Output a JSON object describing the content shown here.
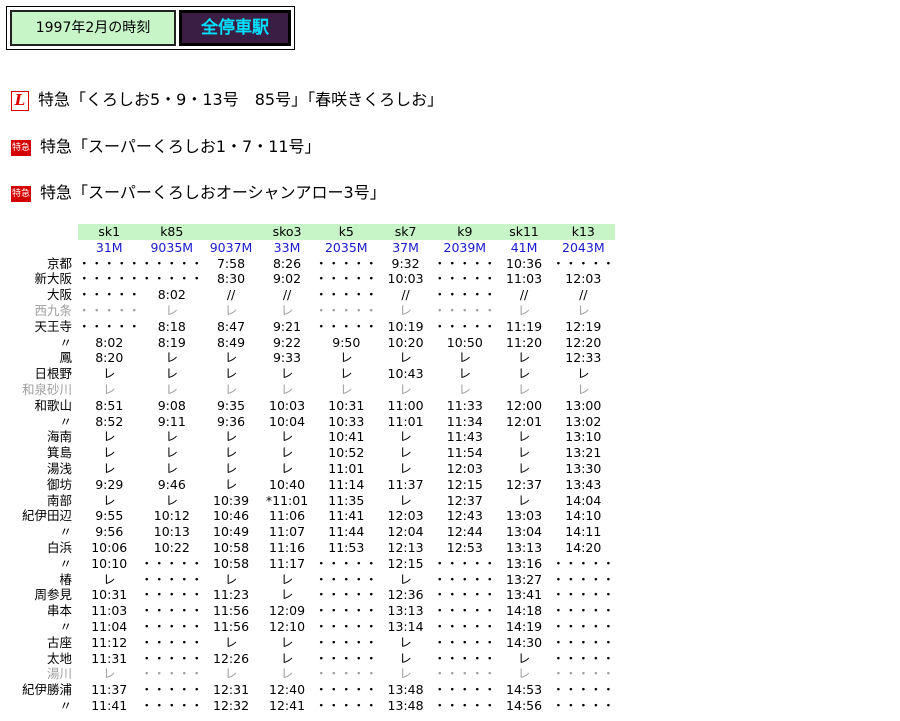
{
  "header": {
    "period": "1997年2月の時刻",
    "category": "全停車駅"
  },
  "services": [
    {
      "icon": "l-mark-icon",
      "label": "特急「くろしお5・9・13号　85号」「春咲きくろしお」"
    },
    {
      "icon": "tokkyu-icon",
      "label": "特急「スーパーくろしお1・7・11号」"
    },
    {
      "icon": "tokkyu-icon",
      "label": "特急「スーパーくろしおオーシャンアロー3号」"
    }
  ],
  "tokkyu_icon_text": "特急",
  "l_mark_text": "L",
  "timetable": {
    "train_names": [
      "sk1",
      "k85",
      "",
      "sko3",
      "k5",
      "sk7",
      "k9",
      "sk11",
      "k13"
    ],
    "train_numbers": [
      "31M",
      "9035M",
      "9037M",
      "33M",
      "2035M",
      "37M",
      "2039M",
      "41M",
      "2043M"
    ],
    "rows": [
      {
        "station": "京都",
        "gray": false,
        "times": [
          "・・・・・",
          "・・・・・",
          "7:58",
          "8:26",
          "・・・・・",
          "9:32",
          "・・・・・",
          "10:36",
          "・・・・・"
        ]
      },
      {
        "station": "新大阪",
        "gray": false,
        "times": [
          "・・・・・",
          "・・・・・",
          "8:30",
          "9:02",
          "・・・・・",
          "10:03",
          "・・・・・",
          "11:03",
          "12:03"
        ]
      },
      {
        "station": "大阪",
        "gray": false,
        "times": [
          "・・・・・",
          "8:02",
          "//",
          "//",
          "・・・・・",
          "//",
          "・・・・・",
          "//",
          "//"
        ]
      },
      {
        "station": "西九条",
        "gray": true,
        "times": [
          "・・・・・",
          "レ",
          "レ",
          "レ",
          "・・・・・",
          "レ",
          "・・・・・",
          "レ",
          "レ"
        ]
      },
      {
        "station": "天王寺",
        "gray": false,
        "times": [
          "・・・・・",
          "8:18",
          "8:47",
          "9:21",
          "・・・・・",
          "10:19",
          "・・・・・",
          "11:19",
          "12:19"
        ]
      },
      {
        "station": "〃",
        "gray": false,
        "times": [
          "8:02",
          "8:19",
          "8:49",
          "9:22",
          "9:50",
          "10:20",
          "10:50",
          "11:20",
          "12:20"
        ]
      },
      {
        "station": "鳳",
        "gray": false,
        "times": [
          "8:20",
          "レ",
          "レ",
          "9:33",
          "レ",
          "レ",
          "レ",
          "レ",
          "12:33"
        ]
      },
      {
        "station": "日根野",
        "gray": false,
        "times": [
          "レ",
          "レ",
          "レ",
          "レ",
          "レ",
          "10:43",
          "レ",
          "レ",
          "レ"
        ]
      },
      {
        "station": "和泉砂川",
        "gray": true,
        "times": [
          "レ",
          "レ",
          "レ",
          "レ",
          "レ",
          "レ",
          "レ",
          "レ",
          "レ"
        ]
      },
      {
        "station": "和歌山",
        "gray": false,
        "times": [
          "8:51",
          "9:08",
          "9:35",
          "10:03",
          "10:31",
          "11:00",
          "11:33",
          "12:00",
          "13:00"
        ]
      },
      {
        "station": "〃",
        "gray": false,
        "times": [
          "8:52",
          "9:11",
          "9:36",
          "10:04",
          "10:33",
          "11:01",
          "11:34",
          "12:01",
          "13:02"
        ]
      },
      {
        "station": "海南",
        "gray": false,
        "times": [
          "レ",
          "レ",
          "レ",
          "レ",
          "10:41",
          "レ",
          "11:43",
          "レ",
          "13:10"
        ]
      },
      {
        "station": "箕島",
        "gray": false,
        "times": [
          "レ",
          "レ",
          "レ",
          "レ",
          "10:52",
          "レ",
          "11:54",
          "レ",
          "13:21"
        ]
      },
      {
        "station": "湯浅",
        "gray": false,
        "times": [
          "レ",
          "レ",
          "レ",
          "レ",
          "11:01",
          "レ",
          "12:03",
          "レ",
          "13:30"
        ]
      },
      {
        "station": "御坊",
        "gray": false,
        "times": [
          "9:29",
          "9:46",
          "レ",
          "10:40",
          "11:14",
          "11:37",
          "12:15",
          "12:37",
          "13:43"
        ]
      },
      {
        "station": "南部",
        "gray": false,
        "times": [
          "レ",
          "レ",
          "10:39",
          "*11:01",
          "11:35",
          "レ",
          "12:37",
          "レ",
          "14:04"
        ]
      },
      {
        "station": "紀伊田辺",
        "gray": false,
        "times": [
          "9:55",
          "10:12",
          "10:46",
          "11:06",
          "11:41",
          "12:03",
          "12:43",
          "13:03",
          "14:10"
        ]
      },
      {
        "station": "〃",
        "gray": false,
        "times": [
          "9:56",
          "10:13",
          "10:49",
          "11:07",
          "11:44",
          "12:04",
          "12:44",
          "13:04",
          "14:11"
        ]
      },
      {
        "station": "白浜",
        "gray": false,
        "times": [
          "10:06",
          "10:22",
          "10:58",
          "11:16",
          "11:53",
          "12:13",
          "12:53",
          "13:13",
          "14:20"
        ]
      },
      {
        "station": "〃",
        "gray": false,
        "times": [
          "10:10",
          "・・・・・",
          "10:58",
          "11:17",
          "・・・・・",
          "12:15",
          "・・・・・",
          "13:16",
          "・・・・・"
        ]
      },
      {
        "station": "椿",
        "gray": false,
        "times": [
          "レ",
          "・・・・・",
          "レ",
          "レ",
          "・・・・・",
          "レ",
          "・・・・・",
          "13:27",
          "・・・・・"
        ]
      },
      {
        "station": "周参見",
        "gray": false,
        "times": [
          "10:31",
          "・・・・・",
          "11:23",
          "レ",
          "・・・・・",
          "12:36",
          "・・・・・",
          "13:41",
          "・・・・・"
        ]
      },
      {
        "station": "串本",
        "gray": false,
        "times": [
          "11:03",
          "・・・・・",
          "11:56",
          "12:09",
          "・・・・・",
          "13:13",
          "・・・・・",
          "14:18",
          "・・・・・"
        ]
      },
      {
        "station": "〃",
        "gray": false,
        "times": [
          "11:04",
          "・・・・・",
          "11:56",
          "12:10",
          "・・・・・",
          "13:14",
          "・・・・・",
          "14:19",
          "・・・・・"
        ]
      },
      {
        "station": "古座",
        "gray": false,
        "times": [
          "11:12",
          "・・・・・",
          "レ",
          "レ",
          "・・・・・",
          "レ",
          "・・・・・",
          "14:30",
          "・・・・・"
        ]
      },
      {
        "station": "太地",
        "gray": false,
        "times": [
          "11:31",
          "・・・・・",
          "12:26",
          "レ",
          "・・・・・",
          "レ",
          "・・・・・",
          "レ",
          "・・・・・"
        ]
      },
      {
        "station": "湯川",
        "gray": true,
        "times": [
          "レ",
          "・・・・・",
          "レ",
          "レ",
          "・・・・・",
          "レ",
          "・・・・・",
          "レ",
          "・・・・・"
        ]
      },
      {
        "station": "紀伊勝浦",
        "gray": false,
        "times": [
          "11:37",
          "・・・・・",
          "12:31",
          "12:40",
          "・・・・・",
          "13:48",
          "・・・・・",
          "14:53",
          "・・・・・"
        ]
      },
      {
        "station": "〃",
        "gray": false,
        "times": [
          "11:41",
          "・・・・・",
          "12:32",
          "12:41",
          "・・・・・",
          "13:48",
          "・・・・・",
          "14:56",
          "・・・・・"
        ]
      }
    ]
  }
}
